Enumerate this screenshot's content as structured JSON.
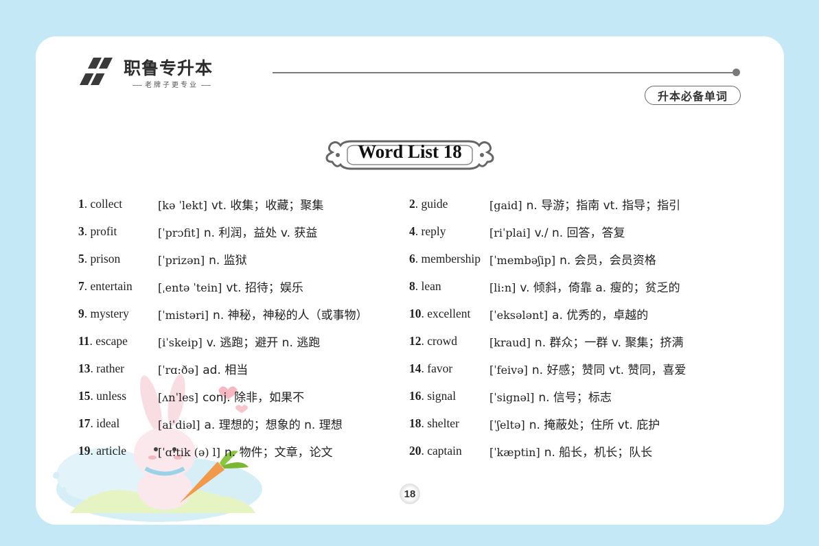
{
  "brand": {
    "name": "职鲁专升本",
    "slogan": "老牌子更专业"
  },
  "badge": "升本必备单词",
  "title": "Word List 18",
  "page_number": "18",
  "entries": [
    {
      "num": "1",
      "word": "collect",
      "phonetic": "[kə ˈlekt]",
      "defs": "vt. 收集；收藏；聚集"
    },
    {
      "num": "2",
      "word": "guide",
      "phonetic": "[gaid]",
      "defs": "n. 导游；指南  vt. 指导；指引"
    },
    {
      "num": "3",
      "word": "profit",
      "phonetic": "[ˈprɔfit]",
      "defs": "n. 利润，益处  v. 获益"
    },
    {
      "num": "4",
      "word": "reply",
      "phonetic": "[riˈplai]",
      "defs": "v./ n. 回答，答复"
    },
    {
      "num": "5",
      "word": "prison",
      "phonetic": "[ˈprizən]",
      "defs": "n. 监狱"
    },
    {
      "num": "6",
      "word": "membership",
      "phonetic": "[ˈmembəʃip]",
      "defs": "n. 会员，会员资格"
    },
    {
      "num": "7",
      "word": "entertain",
      "phonetic": "[ˌentə ˈtein]",
      "defs": "vt. 招待；娱乐"
    },
    {
      "num": "8",
      "word": "lean",
      "phonetic": "[li:n]",
      "defs": "v. 倾斜，倚靠  a. 瘦的；贫乏的"
    },
    {
      "num": "9",
      "word": "mystery",
      "phonetic": "[ˈmistəri]",
      "defs": "n. 神秘，神秘的人（或事物）"
    },
    {
      "num": "10",
      "word": "excellent",
      "phonetic": "[ˈeksələnt]",
      "defs": "a. 优秀的，卓越的"
    },
    {
      "num": "11",
      "word": "escape",
      "phonetic": "[iˈskeip]",
      "defs": "v. 逃跑；避开  n. 逃跑"
    },
    {
      "num": "12",
      "word": "crowd",
      "phonetic": "[kraud]",
      "defs": "n. 群众；一群  v. 聚集；挤满"
    },
    {
      "num": "13",
      "word": "rather",
      "phonetic": "[ˈrɑ:ðə]",
      "defs": "ad. 相当"
    },
    {
      "num": "14",
      "word": "favor",
      "phonetic": "[ˈfeivə]",
      "defs": "n. 好感；赞同  vt. 赞同，喜爱"
    },
    {
      "num": "15",
      "word": "unless",
      "phonetic": "[ʌnˈles]",
      "defs": "conj. 除非，如果不"
    },
    {
      "num": "16",
      "word": "signal",
      "phonetic": "[ˈsignəl]",
      "defs": "n. 信号；标志"
    },
    {
      "num": "17",
      "word": "ideal",
      "phonetic": "[aiˈdiəl]",
      "defs": "a. 理想的；想象的  n. 理想"
    },
    {
      "num": "18",
      "word": "shelter",
      "phonetic": "[ˈʃeltə]",
      "defs": "n. 掩蔽处；住所  vt. 庇护"
    },
    {
      "num": "19",
      "word": "article",
      "phonetic": "[ˈɑ:tik (ə) l]",
      "defs": "n. 物件；文章，论文"
    },
    {
      "num": "20",
      "word": "captain",
      "phonetic": "[ˈkæptin]",
      "defs": "n. 船长，机长；队长"
    }
  ]
}
